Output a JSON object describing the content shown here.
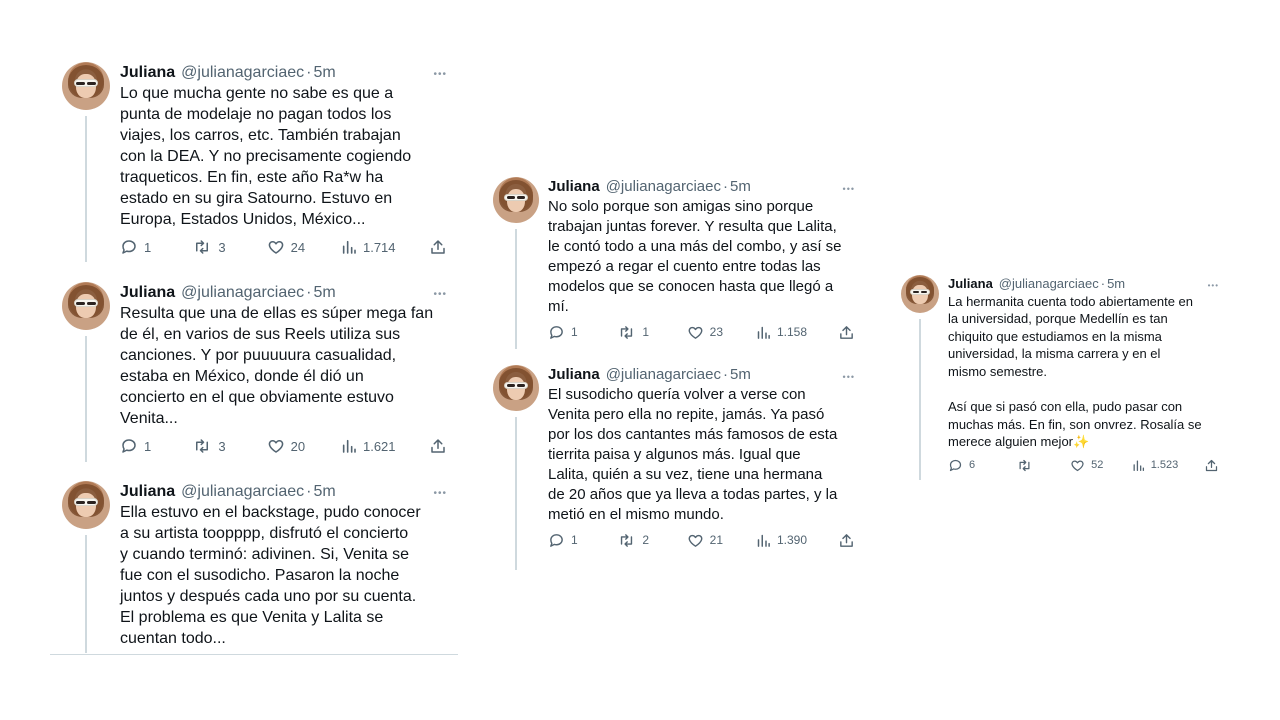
{
  "author": {
    "name": "Juliana",
    "handle": "@julianagarciaec",
    "time": "5m",
    "separator": "·"
  },
  "more_glyph": "•••",
  "column1": [
    {
      "text": "Lo que mucha gente no sabe es que a\npunta de modelaje no pagan todos los\nviajes, los carros, etc. También trabajan\ncon la DEA. Y no precisamente cogiendo\ntraqueticos. En fin, este año Ra*w ha\nestado en su gira Satourno. Estuvo en\nEuropa, Estados Unidos, México...",
      "replies": "1",
      "reposts": "3",
      "likes": "24",
      "views": "1.714"
    },
    {
      "text": "Resulta que una de ellas es súper mega fan\nde él, en varios de sus Reels utiliza sus\ncanciones. Y por puuuuura casualidad,\nestaba en México, donde él dió un\nconcierto en el que obviamente estuvo\nVenita...",
      "replies": "1",
      "reposts": "3",
      "likes": "20",
      "views": "1.621"
    },
    {
      "text": "Ella estuvo en el backstage, pudo conocer\na su artista toopppp, disfrutó el concierto\ny cuando terminó: adivinen. Si, Venita se\nfue con el susodicho. Pasaron la noche\njuntos y después cada uno por su cuenta.\nEl problema es que Venita y Lalita se\ncuentan todo..."
    }
  ],
  "column2": [
    {
      "text": "No solo porque son amigas sino porque\ntrabajan juntas forever. Y resulta que Lalita,\nle contó todo a una más del combo, y así se\nempezó a regar el cuento entre todas las\nmodelos que se conocen hasta que llegó a\nmí.",
      "replies": "1",
      "reposts": "1",
      "likes": "23",
      "views": "1.158"
    },
    {
      "text": "El susodicho quería volver a verse con\nVenita pero ella no repite, jamás. Ya pasó\npor los dos cantantes más famosos de esta\ntierrita paisa y algunos más. Igual que\nLalita, quién a su vez, tiene una hermana\nde 20 años que ya lleva a todas partes, y la\nmetió en el mismo mundo.",
      "replies": "1",
      "reposts": "2",
      "likes": "21",
      "views": "1.390"
    }
  ],
  "column3": [
    {
      "text": "La hermanita cuenta todo abiertamente en\nla universidad, porque Medellín es tan\nchiquito que estudiamos en la misma\nuniversidad, la misma carrera y en el\nmismo semestre.\n\nAsí que si pasó con ella, pudo pasar con\nmuchas más. En fin, son onvrez. Rosalía se\nmerece alguien mejor✨",
      "replies": "6",
      "reposts": "",
      "likes": "52",
      "views": "1.523"
    }
  ],
  "icons": {
    "reply": "reply-icon",
    "repost": "repost-icon",
    "like": "heart-icon",
    "views": "views-icon",
    "share": "share-icon",
    "more": "more-icon"
  },
  "colors": {
    "text": "#0f1419",
    "secondary": "#536471",
    "line": "#cfd9de"
  }
}
